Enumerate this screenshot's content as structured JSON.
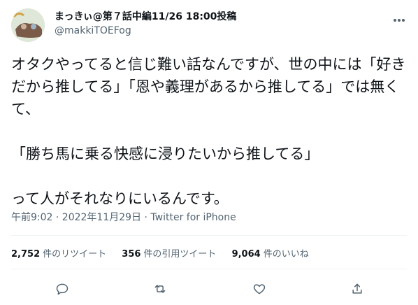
{
  "user": {
    "display_name": "まっきぃ@第７話中編11/26 18:00投稿",
    "handle": "@makkiTOEFog"
  },
  "tweet": {
    "text": "オタクやってると信じ難い話なんですが、世の中には「好きだから推してる」「恩や義理があるから推してる」では無くて、\n\n「勝ち馬に乗る快感に浸りたいから推してる」\n\nって人がそれなりにいるんです。",
    "meta": "午前9:02 · 2022年11月29日 · Twitter for iPhone"
  },
  "stats": {
    "retweets_count": "2,752",
    "retweets_label": "件のリツイート",
    "quotes_count": "356",
    "quotes_label": "件の引用ツイート",
    "likes_count": "9,064",
    "likes_label": "件のいいね"
  },
  "icons": [
    "more-icon",
    "reply-icon",
    "retweet-icon",
    "like-icon",
    "share-icon"
  ]
}
